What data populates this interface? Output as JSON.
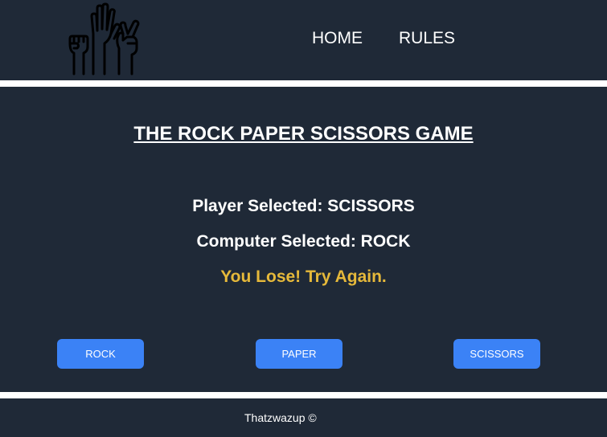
{
  "header": {
    "logo_icon": "raised-hands-rock-paper-scissors-icon",
    "nav": [
      {
        "label": "HOME"
      },
      {
        "label": "RULES"
      }
    ]
  },
  "main": {
    "title": "THE ROCK PAPER SCISSORS GAME",
    "player_selected": "Player Selected: SCISSORS",
    "computer_selected": "Computer Selected: ROCK",
    "result": "You Lose! Try Again.",
    "buttons": {
      "rock": "ROCK",
      "paper": "PAPER",
      "scissors": "SCISSORS"
    }
  },
  "footer": {
    "text": "Thatzwazup ©"
  },
  "colors": {
    "background": "#1f2937",
    "divider": "#ffffff",
    "button": "#3b82f6",
    "result": "#e6b93a"
  }
}
